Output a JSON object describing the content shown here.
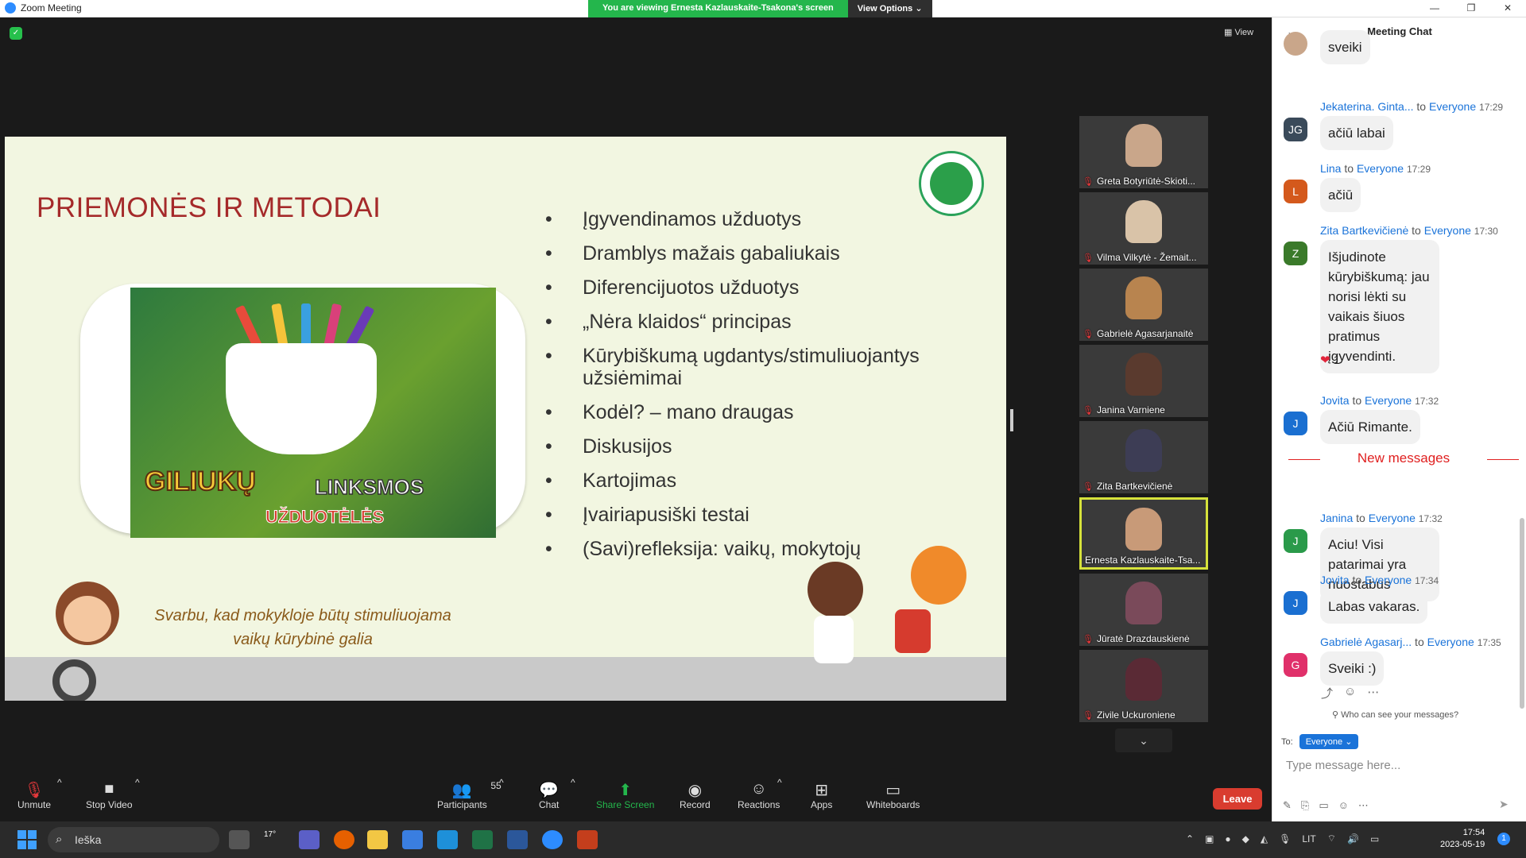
{
  "window": {
    "title": "Zoom Meeting",
    "viewing_banner": "You are viewing Ernesta Kazlauskaite-Tsakona's screen",
    "view_options": "View Options",
    "view_button": "View"
  },
  "slide": {
    "title": "PRIEMONĖS IR METODAI",
    "bullets": [
      "Įgyvendinamos užduotys",
      "Dramblys mažais gabaliukais",
      "Diferencijuotos užduotys",
      "„Nėra klaidos“ principas",
      "Kūrybiškumą ugdantys/stimuliuojantys užsiėmimai",
      "Kodėl? – mano draugas",
      "Diskusijos",
      "Kartojimas",
      "Įvairiapusiški testai",
      "(Savi)refleksija: vaikų, mokytojų"
    ],
    "book_title_1": "GILIUKŲ",
    "book_title_2": "LINKSMOS",
    "book_title_3": "UŽDUOTĖLĖS",
    "quote_line_1": "Svarbu, kad mokykloje būtų stimuliuojama",
    "quote_line_2": "vaikų kūrybinė galia"
  },
  "gallery": {
    "participants": [
      {
        "name": "Greta Botyriūtė-Skioti...",
        "muted": true,
        "active": false,
        "color": "#c9a68a"
      },
      {
        "name": "Vilma Vilkytė - Žemait...",
        "muted": true,
        "active": false,
        "color": "#d9c3a8"
      },
      {
        "name": "Gabrielė Agasarjanaitė",
        "muted": true,
        "active": false,
        "color": "#b8844f"
      },
      {
        "name": "Janina Varniene",
        "muted": true,
        "active": false,
        "color": "#5a3a2e"
      },
      {
        "name": "Zita Bartkevičienė",
        "muted": true,
        "active": false,
        "color": "#3d3d55"
      },
      {
        "name": "Ernesta Kazlauskaite-Tsa...",
        "muted": false,
        "active": true,
        "color": "#c89a78"
      },
      {
        "name": "Jūratė Drazdauskienė",
        "muted": true,
        "active": false,
        "color": "#7a4a5a"
      },
      {
        "name": "Zivile Uckuroniene",
        "muted": true,
        "active": false,
        "color": "#5a2a35"
      }
    ],
    "more_icon": "chevron-down-icon"
  },
  "chat": {
    "title": "Meeting Chat",
    "messages": [
      {
        "sender": "",
        "to": "",
        "time": "",
        "avatar": "",
        "avatar_color": "#c9a68a",
        "text": "sveiki"
      },
      {
        "sender": "Jekaterina. Ginta...",
        "to": "Everyone",
        "time": "17:29",
        "avatar": "JG",
        "avatar_color": "#3a4a5a",
        "text": "ačiū labai"
      },
      {
        "sender": "Lina",
        "to": "Everyone",
        "time": "17:29",
        "avatar": "L",
        "avatar_color": "#d4591c",
        "text": "ačiū"
      },
      {
        "sender": "Zita Bartkevičienė",
        "to": "Everyone",
        "time": "17:30",
        "avatar": "Z",
        "avatar_color": "#3a7a2a",
        "text": "Išjudinote kūrybiškumą: jau norisi lėkti su vaikais šiuos pratimus įgyvendinti."
      },
      {
        "sender": "Jovita",
        "to": "Everyone",
        "time": "17:32",
        "avatar": "J",
        "avatar_color": "#1a6fd1",
        "text": "Ačiū Rimante."
      },
      {
        "sender": "Janina",
        "to": "Everyone",
        "time": "17:32",
        "avatar": "J",
        "avatar_color": "#2a9a4a",
        "text": "Aciu! Visi patarimai yra nuostabus"
      },
      {
        "sender": "Jovita",
        "to": "Everyone",
        "time": "17:34",
        "avatar": "J",
        "avatar_color": "#1a6fd1",
        "text": "Labas vakaras."
      },
      {
        "sender": "Gabrielė Agasarj...",
        "to": "Everyone",
        "time": "17:35",
        "avatar": "G",
        "avatar_color": "#e0306a",
        "text": "Sveiki :)"
      }
    ],
    "reaction_count": "1",
    "new_messages_label": "New messages",
    "who_can_see": "Who can see your messages?",
    "to_label": "To:",
    "to_value": "Everyone",
    "input_placeholder": "Type message here..."
  },
  "toolbar": {
    "unmute": "Unmute",
    "stop_video": "Stop Video",
    "participants": "Participants",
    "participants_count": "55",
    "chat": "Chat",
    "share_screen": "Share Screen",
    "record": "Record",
    "reactions": "Reactions",
    "apps": "Apps",
    "whiteboards": "Whiteboards",
    "leave": "Leave"
  },
  "taskbar": {
    "search_placeholder": "Ieška",
    "weather": "17°",
    "language": "LIT",
    "time": "17:54",
    "date": "2023-05-19",
    "notifications": "1"
  }
}
